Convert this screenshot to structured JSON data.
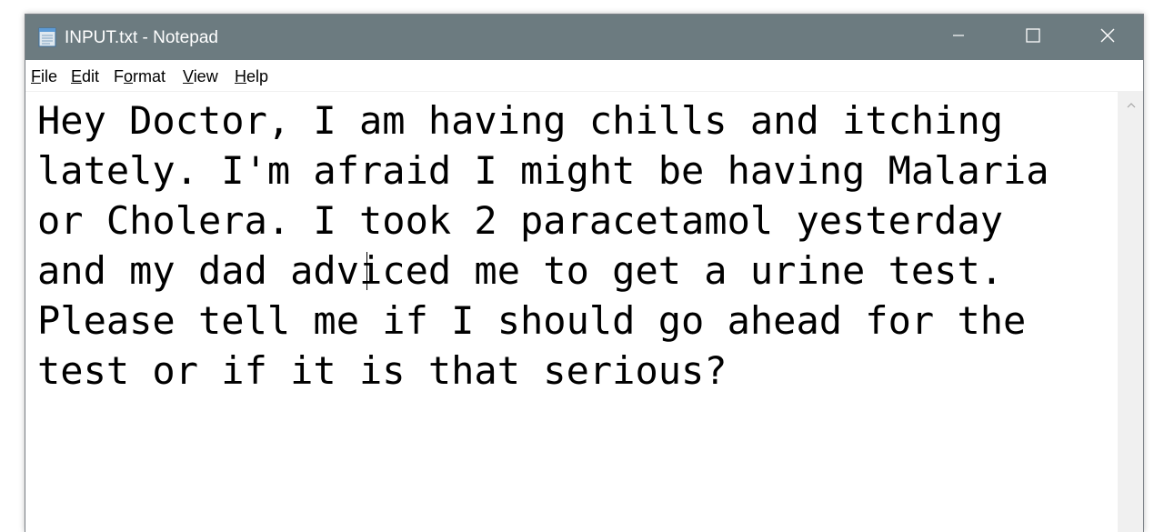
{
  "window": {
    "title": "INPUT.txt - Notepad",
    "icon": "notepad-icon",
    "controls": {
      "minimize_icon": "minimize-icon",
      "maximize_icon": "maximize-icon",
      "close_icon": "close-icon"
    },
    "titlebar_color": "#6c7b80"
  },
  "menu": {
    "file": {
      "accel": "F",
      "rest": "ile"
    },
    "edit": {
      "accel": "E",
      "rest": "dit"
    },
    "format": {
      "pre": "F",
      "accel": "o",
      "rest": "rmat"
    },
    "view": {
      "accel": "V",
      "rest": "iew"
    },
    "help": {
      "accel": "H",
      "rest": "elp"
    }
  },
  "document": {
    "text": "Hey Doctor, I am having chills and itching\nlately. I'm afraid I might be having Malaria\nor Cholera. I took 2 paracetamol yesterday\nand my dad adviced me to get a urine test.\nPlease tell me if I should go ahead for the\ntest or if it is that serious?"
  },
  "scrollbar": {
    "up_icon": "scroll-up-arrow-icon"
  }
}
